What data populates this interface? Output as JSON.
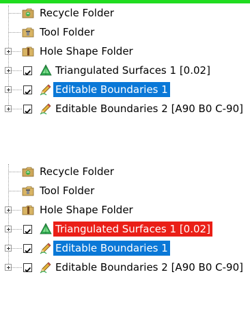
{
  "panels": [
    {
      "items": [
        {
          "label": "Recycle Folder",
          "icon": "recycle-folder-icon",
          "expandable": false,
          "checkbox": false,
          "highlight": "none"
        },
        {
          "label": "Tool Folder",
          "icon": "tool-folder-icon",
          "expandable": false,
          "checkbox": false,
          "highlight": "none"
        },
        {
          "label": "Hole Shape Folder",
          "icon": "hole-shape-folder-icon",
          "expandable": true,
          "checkbox": false,
          "highlight": "none"
        },
        {
          "label": "Triangulated Surfaces 1 [0.02]",
          "icon": "triangulated-surface-icon",
          "expandable": true,
          "checkbox": true,
          "checked": true,
          "highlight": "none"
        },
        {
          "label": "Editable Boundaries 1",
          "icon": "pencil-boundary-icon",
          "expandable": true,
          "checkbox": true,
          "checked": true,
          "highlight": "blue"
        },
        {
          "label": "Editable Boundaries 2 [A90 B0 C-90]",
          "icon": "pencil-boundary-icon",
          "expandable": true,
          "checkbox": true,
          "checked": true,
          "highlight": "none"
        }
      ]
    },
    {
      "items": [
        {
          "label": "Recycle Folder",
          "icon": "recycle-folder-icon",
          "expandable": false,
          "checkbox": false,
          "highlight": "none"
        },
        {
          "label": "Tool Folder",
          "icon": "tool-folder-icon",
          "expandable": false,
          "checkbox": false,
          "highlight": "none"
        },
        {
          "label": "Hole Shape Folder",
          "icon": "hole-shape-folder-icon",
          "expandable": true,
          "checkbox": false,
          "highlight": "none"
        },
        {
          "label": "Triangulated Surfaces 1 [0.02]",
          "icon": "triangulated-surface-icon",
          "expandable": true,
          "checkbox": true,
          "checked": true,
          "highlight": "red"
        },
        {
          "label": "Editable Boundaries 1",
          "icon": "pencil-boundary-icon",
          "expandable": true,
          "checkbox": true,
          "checked": true,
          "highlight": "blue"
        },
        {
          "label": "Editable Boundaries 2 [A90 B0 C-90]",
          "icon": "pencil-boundary-icon",
          "expandable": true,
          "checkbox": true,
          "checked": true,
          "highlight": "none"
        }
      ]
    }
  ],
  "colors": {
    "top_bar": "#20dc20",
    "highlight_blue": "#0a78d7",
    "highlight_red": "#ea1f17"
  }
}
